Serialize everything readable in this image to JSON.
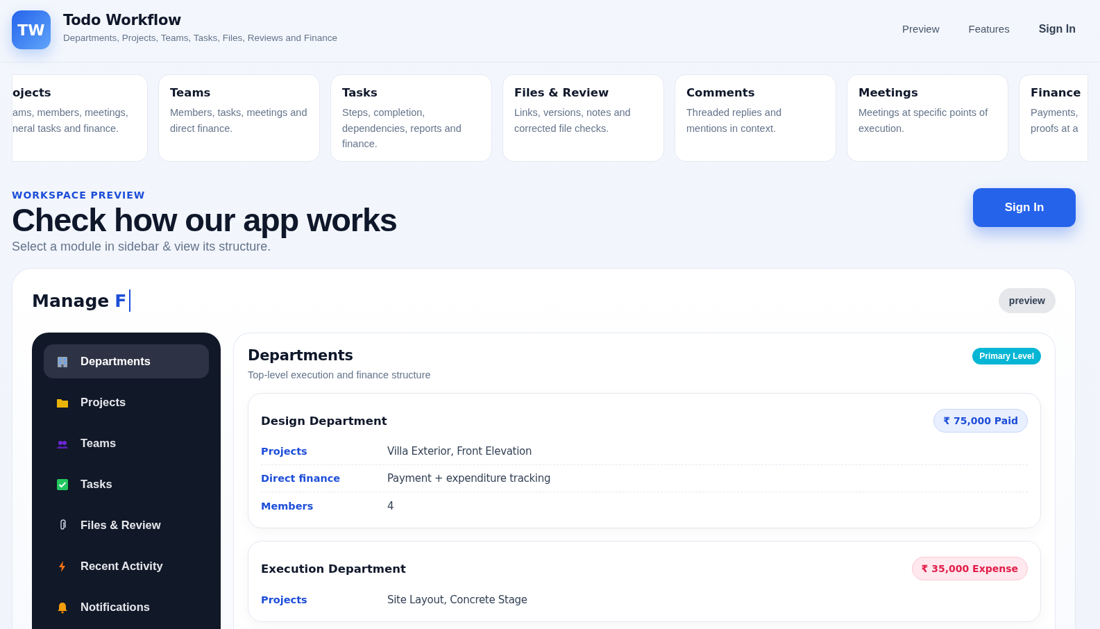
{
  "header": {
    "logo": "TW",
    "title": "Todo Workflow",
    "subtitle": "Departments, Projects, Teams, Tasks, Files, Reviews and Finance",
    "nav": [
      {
        "label": "Preview",
        "kind": "link"
      },
      {
        "label": "Features",
        "kind": "link"
      },
      {
        "label": "Sign In",
        "kind": "strong"
      }
    ]
  },
  "feature_cards": [
    {
      "title": "ojects",
      "lines": [
        "ams, members, meetings,",
        "neral tasks and finance."
      ],
      "kind": "clipped_left"
    },
    {
      "title": "Teams",
      "lines": [
        "Members, tasks, meetings and",
        "direct finance."
      ],
      "kind": "full"
    },
    {
      "title": "Tasks",
      "lines": [
        "Steps, completion,",
        "dependencies, reports and",
        "finance."
      ],
      "kind": "full"
    },
    {
      "title": "Files & Review",
      "lines": [
        "Links, versions, notes and",
        "corrected file checks."
      ],
      "kind": "full"
    },
    {
      "title": "Comments",
      "lines": [
        "Threaded replies and",
        "mentions in context."
      ],
      "kind": "full"
    },
    {
      "title": "Meetings",
      "lines": [
        "Meetings at specific points of",
        "execution."
      ],
      "kind": "full"
    },
    {
      "title": "Finance",
      "lines": [
        "Payments,",
        "proofs at a"
      ],
      "kind": "clipped_right"
    }
  ],
  "section": {
    "eyebrow": "WORKSPACE PREVIEW",
    "title": "Check how our app works",
    "subtitle": "Select a module in sidebar & view its structure.",
    "button": "Sign In"
  },
  "panel": {
    "title": "Manage",
    "typed": "F",
    "pill": "preview",
    "sidebar": [
      {
        "label": "Departments",
        "selected": true
      },
      {
        "label": "Projects",
        "selected": false
      },
      {
        "label": "Teams",
        "selected": false
      },
      {
        "label": "Tasks",
        "selected": false
      },
      {
        "label": "Files & Review",
        "selected": false
      },
      {
        "label": "Recent Activity",
        "selected": false
      },
      {
        "label": "Notifications",
        "selected": false
      }
    ],
    "content": {
      "title": "Departments",
      "subtitle": "Top-level execution and finance structure",
      "badge": "Primary Level",
      "departments": [
        {
          "name": "Design Department",
          "amount": "₹ 75,000 Paid",
          "kind": "paid",
          "rows": [
            {
              "label": "Projects",
              "value": "Villa Exterior, Front Elevation"
            },
            {
              "label": "Direct finance",
              "value": "Payment + expenditure tracking"
            },
            {
              "label": "Members",
              "value": "4"
            }
          ]
        },
        {
          "name": "Execution Department",
          "amount": "₹ 35,000 Expense",
          "kind": "expense",
          "rows": [
            {
              "label": "Projects",
              "value": "Site Layout, Concrete Stage"
            }
          ]
        }
      ]
    }
  }
}
